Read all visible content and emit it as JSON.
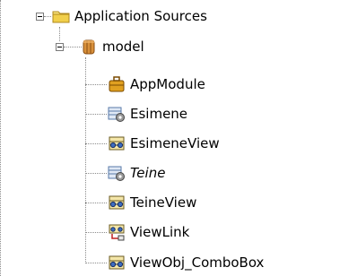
{
  "tree": {
    "root": {
      "label": "Application Sources",
      "icon": "folder-icon",
      "expanded": true
    },
    "package": {
      "label": "model",
      "icon": "package-icon",
      "expanded": true
    },
    "items": [
      {
        "label": "AppModule",
        "icon": "application-module-icon",
        "italic": false
      },
      {
        "label": "Esimene",
        "icon": "entity-object-icon",
        "italic": false
      },
      {
        "label": "EsimeneView",
        "icon": "view-object-icon",
        "italic": false
      },
      {
        "label": "Teine",
        "icon": "entity-object-icon",
        "italic": true
      },
      {
        "label": "TeineView",
        "icon": "view-object-icon",
        "italic": false
      },
      {
        "label": "ViewLink",
        "icon": "view-link-icon",
        "italic": false
      },
      {
        "label": "ViewObj_ComboBox",
        "icon": "view-object-icon",
        "italic": false
      }
    ]
  }
}
